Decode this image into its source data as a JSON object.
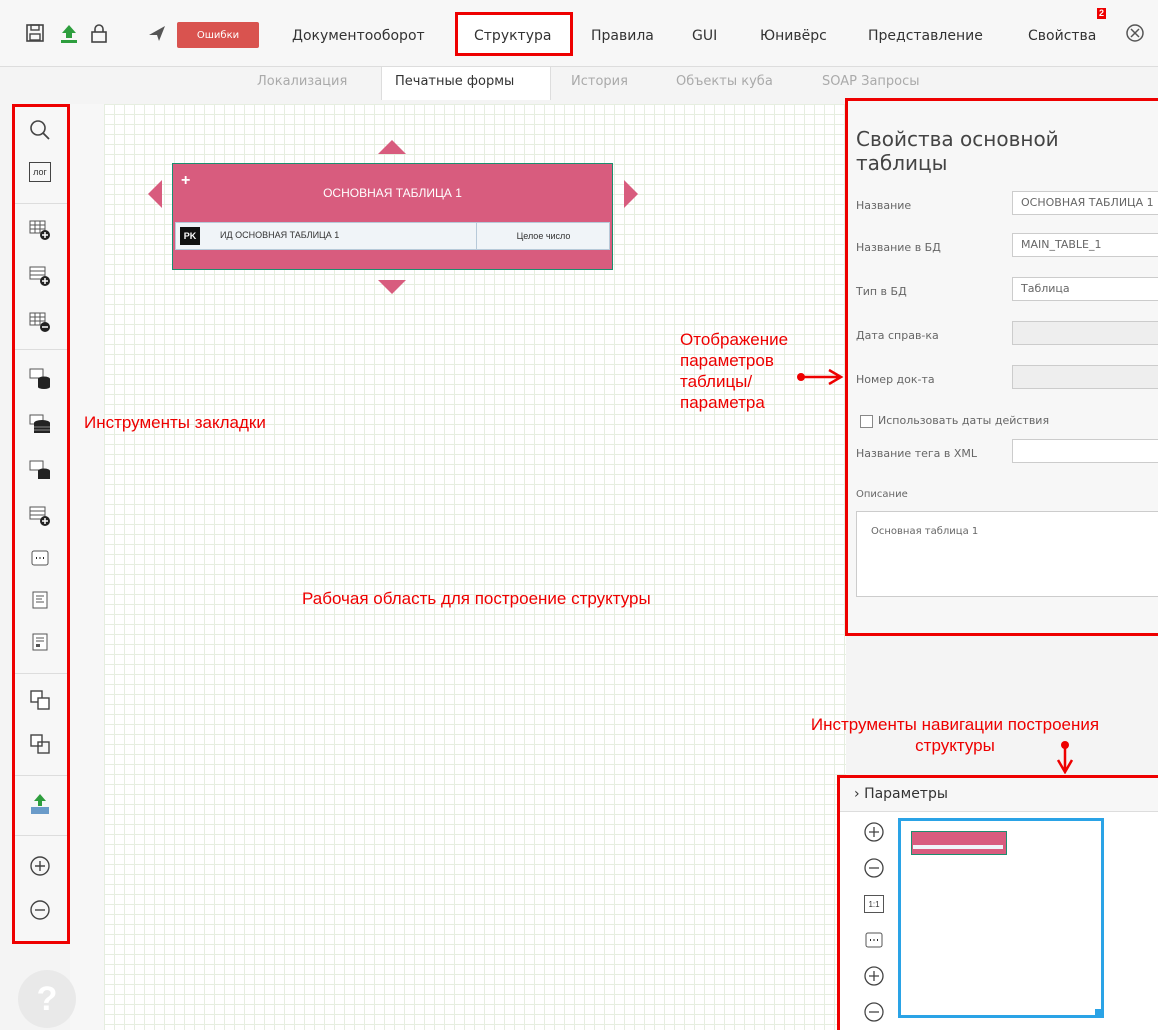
{
  "topbar": {
    "errors_label": "Ошибки",
    "menu": [
      "Документооборот",
      "Структура",
      "Правила",
      "GUI",
      "Юнивёрс",
      "Представление",
      "Свойства"
    ],
    "properties_badge": "2",
    "subtabs": [
      "Локализация",
      "Печатные формы",
      "История",
      "Объекты куба",
      "SOAP Запросы"
    ]
  },
  "left_toolbar": {
    "log_label": "лог"
  },
  "entity": {
    "title": "ОСНОВНАЯ ТАБЛИЦА 1",
    "pk": "PK",
    "row_name": "ИД ОСНОВНАЯ ТАБЛИЦА 1",
    "row_type": "Целое число"
  },
  "annotations": {
    "toolbar": "Инструменты закладки",
    "workspace": "Рабочая область для построение структуры",
    "display": "Отображение\nпараметров\nтаблицы/\nпараметра",
    "navigation": "Инструменты навигации построения\nструктуры"
  },
  "properties": {
    "title": "Свойства основной таблицы",
    "name_label": "Название",
    "name_value": "ОСНОВНАЯ ТАБЛИЦА 1",
    "dbname_label": "Название в БД",
    "dbname_value": "MAIN_TABLE_1",
    "dbtype_label": "Тип в БД",
    "dbtype_value": "Таблица",
    "refdate_label": "Дата справ-ка",
    "docnum_label": "Номер док-та",
    "use_dates_label": "Использовать даты действия",
    "xmltag_label": "Название тега в XML",
    "desc_label": "Описание",
    "desc_value": "Основная таблица 1"
  },
  "navigation": {
    "header": "Параметры",
    "zoom_reset_label": "1:1"
  },
  "help": {
    "symbol": "?"
  }
}
